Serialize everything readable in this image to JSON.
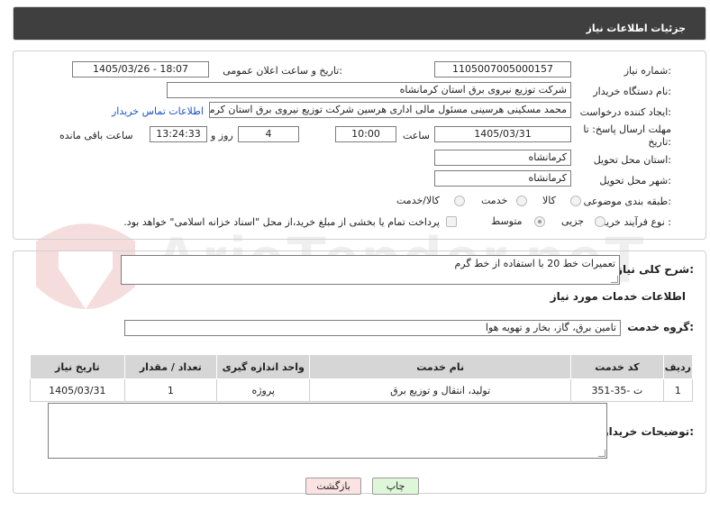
{
  "header": {
    "title": "جزئیات اطلاعات نیاز"
  },
  "fields": {
    "need_number": {
      "label": "شماره نیاز:",
      "value": "1105007005000157"
    },
    "announce": {
      "label": "تاریخ و ساعت اعلان عمومی:",
      "value": "1405/03/26 - 18:07"
    },
    "buyer_org": {
      "label": "نام دستگاه خریدار:",
      "value": "شرکت توزیع نیروی برق استان کرمانشاه"
    },
    "requester": {
      "label": "ایجاد کننده درخواست:",
      "value": "محمد مسکینی هرسینی مسئول مالی اداری هرسین شرکت توزیع نیروی برق استان کرمانشاه",
      "contact_link": "اطلاعات تماس خریدار"
    },
    "deadline": {
      "label_line1": "مهلت ارسال پاسخ: تا",
      "label_line2": "تاریخ:",
      "date": "1405/03/31",
      "time_label": "ساعت",
      "time": "10:00",
      "days": "4",
      "days_label": "روز و",
      "remaining": "13:24:33",
      "remaining_label": "ساعت باقی مانده"
    },
    "province": {
      "label": "استان محل تحویل:",
      "value": "کرمانشاه"
    },
    "city": {
      "label": "شهر محل تحویل:",
      "value": "کرمانشاه"
    },
    "category": {
      "label": "طبقه بندی موضوعی:",
      "options": [
        "کالا",
        "خدمت",
        "کالا/خدمت"
      ]
    },
    "purchase_type": {
      "label": "نوع فرآیند خرید :",
      "options": [
        "جزیی",
        "متوسط"
      ],
      "note": "پرداخت تمام یا بخشی از مبلغ خرید،از محل \"اسناد خزانه اسلامی\" خواهد بود."
    }
  },
  "summary": {
    "label": "شرح کلی نیاز:",
    "value": "تعمیرات خط 20 با استفاده از خط گرم"
  },
  "services_info": {
    "title": "اطلاعات خدمات مورد نیاز",
    "group_label": "گروه خدمت:",
    "group_value": "تامین برق، گاز، بخار و تهویه هوا"
  },
  "table": {
    "headers": [
      "ردیف",
      "کد خدمت",
      "نام خدمت",
      "واحد اندازه گیری",
      "تعداد / مقدار",
      "تاریخ نیاز"
    ],
    "rows": [
      [
        "1",
        "ت -35-351",
        "تولید، انتقال و توزیع برق",
        "پروژه",
        "1",
        "1405/03/31"
      ]
    ]
  },
  "buyer_notes": {
    "label": "توضیحات خریدار:",
    "value": ""
  },
  "buttons": {
    "print": "چاپ",
    "back": "بازگشت"
  },
  "watermark": {
    "text": "AriaTender.neT"
  },
  "colors": {
    "header_bg": "#3f3f3f",
    "link": "#1a53c8",
    "print_btn": "#dff7d9",
    "back_btn": "#fbe3e3"
  }
}
